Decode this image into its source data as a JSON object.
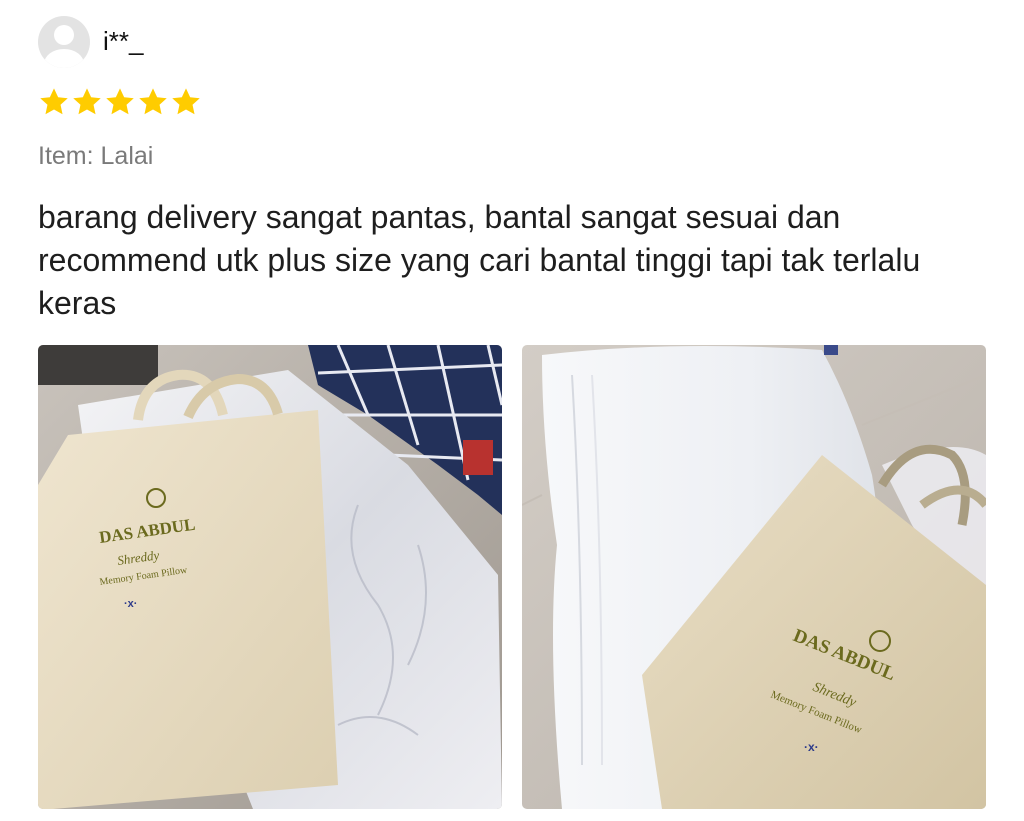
{
  "review": {
    "username": "i**_",
    "rating": 5,
    "rating_max": 5,
    "star_color": "#FFCC00",
    "variation_prefix": "Item:",
    "variation_value": "Lalai",
    "variation_text": "Item: Lalai",
    "comment": "barang delivery sangat pantas, bantal sangat sesuai dan recommend utk plus size yang cari bantal tinggi tapi tak terlalu keras"
  },
  "photos": [
    {
      "brand_text": "DAS ABDUL",
      "product_line": "Shreddy",
      "product_desc": "Memory Foam Pillow"
    },
    {
      "brand_text": "DAS ABDUL",
      "product_line": "Shreddy",
      "product_desc": "Memory Foam Pillow"
    }
  ]
}
